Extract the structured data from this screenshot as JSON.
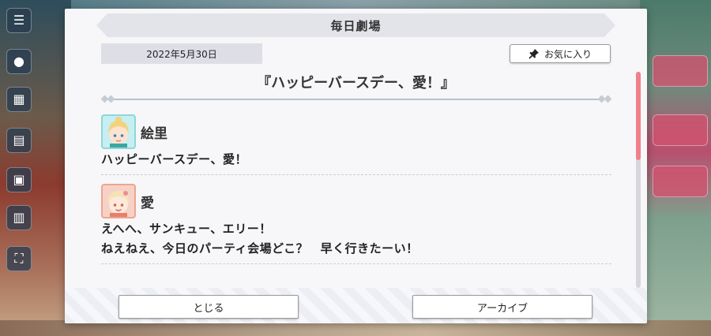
{
  "modal": {
    "title": "毎日劇場",
    "date": "2022年5月30日",
    "favorite_label": "お気に入り",
    "episode_title": "『ハッピーバースデー、愛！』"
  },
  "script": [
    {
      "speaker": "絵里",
      "lines": [
        "ハッピーバースデー、愛！"
      ]
    },
    {
      "speaker": "愛",
      "lines": [
        "えへへ、サンキュー、エリー！",
        "ねえねえ、今日のパーティ会場どこ？　早く行きたーい！"
      ]
    }
  ],
  "footer": {
    "close_label": "とじる",
    "archive_label": "アーカイブ"
  },
  "colors": {
    "accent": "#f07f8a",
    "eli_avatar_bg": "#c7eef0",
    "ai_avatar_bg": "#f6d2c6"
  },
  "scroll_fraction": 0.0
}
